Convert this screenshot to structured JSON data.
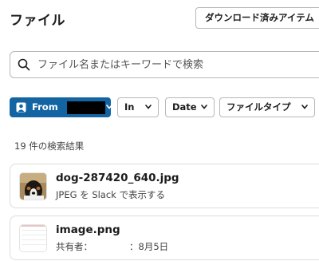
{
  "header": {
    "title": "ファイル",
    "downloaded_button": "ダウンロード済みアイテム"
  },
  "search": {
    "placeholder": "ファイル名またはキーワードで検索",
    "value": ""
  },
  "filters": {
    "from_label": "From",
    "from_value_redacted": true,
    "in_label": "In",
    "date_label": "Date",
    "file_type_label": "ファイルタイプ"
  },
  "results": {
    "count_text": "19 件の検索結果",
    "items": [
      {
        "name": "dog-287420_640.jpg",
        "meta": "JPEG を Slack で表示する",
        "thumbnail": "dog-photo-thumbnail"
      },
      {
        "name": "image.png",
        "owner_label": "共有者：",
        "date": "：8月5日",
        "thumbnail": "image-thumbnail"
      }
    ]
  },
  "colors": {
    "accent": "#1264a3",
    "border": "#b8b8b8",
    "text": "#1d1c1d",
    "muted": "#454245"
  },
  "icons": [
    "search-icon",
    "person-icon",
    "chevron-down-icon"
  ]
}
